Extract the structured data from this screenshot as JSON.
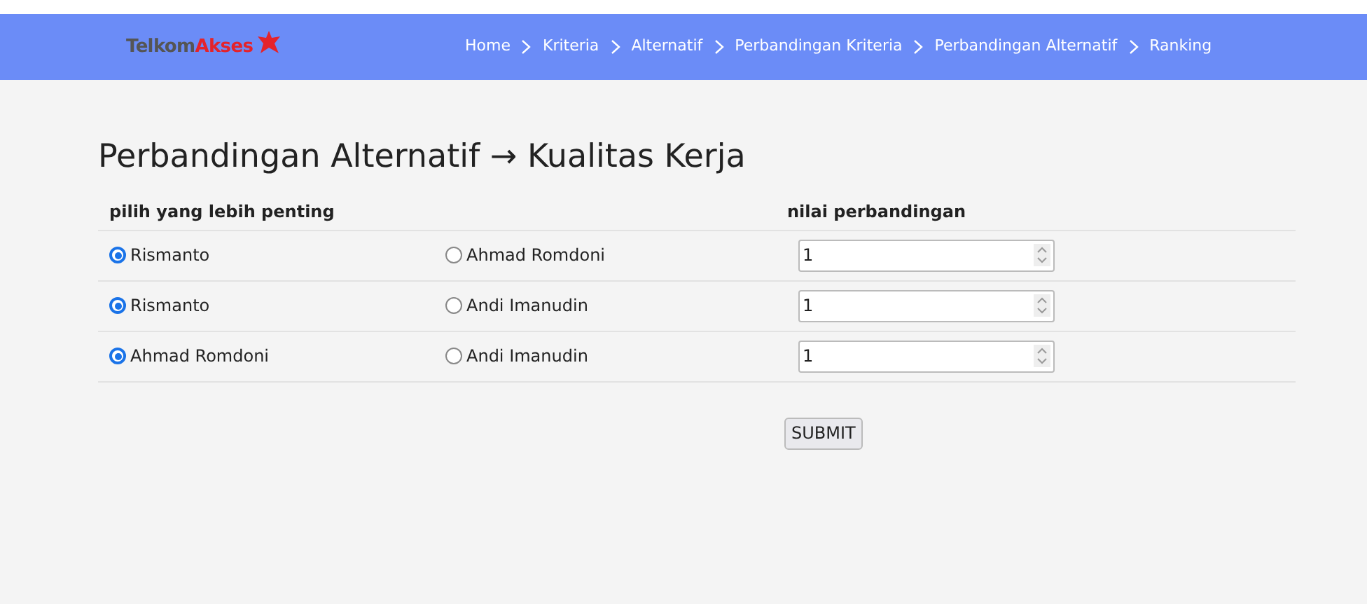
{
  "logo": {
    "part_1": "Telkom",
    "part_2": "Akses"
  },
  "nav": [
    {
      "label": "Home"
    },
    {
      "label": "Kriteria"
    },
    {
      "label": "Alternatif"
    },
    {
      "label": "Perbandingan Kriteria"
    },
    {
      "label": "Perbandingan Alternatif"
    },
    {
      "label": "Ranking"
    }
  ],
  "title": "Perbandingan Alternatif → Kualitas Kerja",
  "table": {
    "columns": [
      "pilih yang lebih penting",
      "nilai perbandingan"
    ],
    "rows": [
      {
        "options": [
          {
            "label": "Rismanto",
            "selected": true
          },
          {
            "label": "Ahmad Romdoni",
            "selected": false
          }
        ],
        "value": "1"
      },
      {
        "options": [
          {
            "label": "Rismanto",
            "selected": true
          },
          {
            "label": "Andi Imanudin",
            "selected": false
          }
        ],
        "value": "1"
      },
      {
        "options": [
          {
            "label": "Ahmad Romdoni",
            "selected": true
          },
          {
            "label": "Andi Imanudin",
            "selected": false
          }
        ],
        "value": "1"
      }
    ]
  },
  "submit": "SUBMIT"
}
